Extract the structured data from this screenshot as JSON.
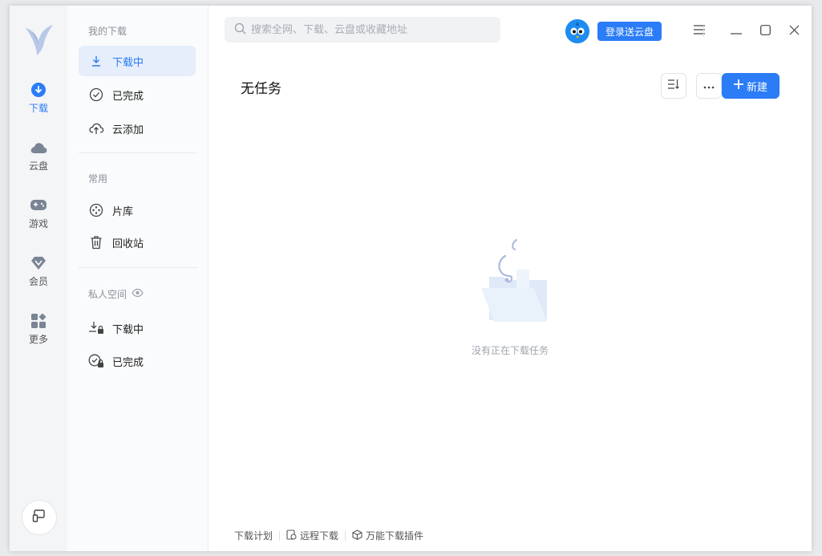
{
  "rail": {
    "items": [
      {
        "label": "下载",
        "icon": "download-circle-icon",
        "active": true
      },
      {
        "label": "云盘",
        "icon": "cloud-icon"
      },
      {
        "label": "游戏",
        "icon": "gamepad-icon"
      },
      {
        "label": "会员",
        "icon": "diamond-icon"
      },
      {
        "label": "更多",
        "icon": "grid-icon"
      }
    ]
  },
  "nav": {
    "section_downloads": "我的下载",
    "downloading": "下载中",
    "completed": "已完成",
    "cloud_add": "云添加",
    "section_common": "常用",
    "library": "片库",
    "recycle": "回收站",
    "section_private": "私人空间",
    "private_downloading": "下载中",
    "private_completed": "已完成"
  },
  "header": {
    "search_placeholder": "搜索全网、下载、云盘或收藏地址",
    "login_button": "登录送云盘"
  },
  "main": {
    "title": "无任务",
    "new_button": "新建",
    "empty_text": "没有正在下载任务"
  },
  "footer": {
    "plan": "下载计划",
    "remote": "远程下载",
    "plugin": "万能下载插件"
  },
  "colors": {
    "accent": "#2b7cf6",
    "rail_bg": "#f4f5f7",
    "nav_active_bg": "#e6eefb"
  }
}
